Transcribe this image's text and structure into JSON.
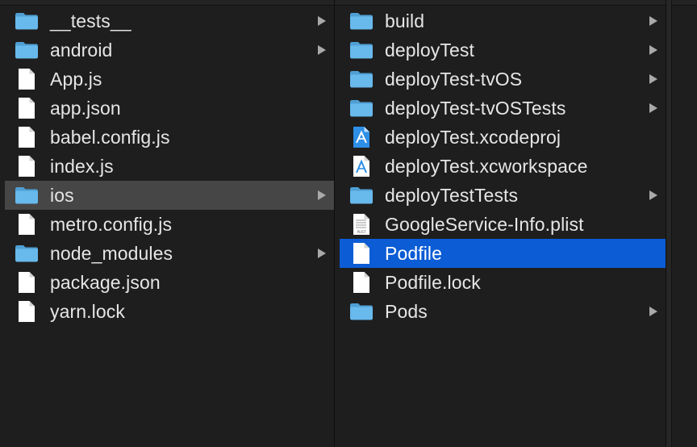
{
  "columns": [
    {
      "items": [
        {
          "label": "__tests__",
          "icon": "folder-icon",
          "has_children": true,
          "state": "normal"
        },
        {
          "label": "android",
          "icon": "folder-icon",
          "has_children": true,
          "state": "normal"
        },
        {
          "label": "App.js",
          "icon": "document-icon",
          "has_children": false,
          "state": "normal"
        },
        {
          "label": "app.json",
          "icon": "document-icon",
          "has_children": false,
          "state": "normal"
        },
        {
          "label": "babel.config.js",
          "icon": "document-icon",
          "has_children": false,
          "state": "normal"
        },
        {
          "label": "index.js",
          "icon": "document-icon",
          "has_children": false,
          "state": "normal"
        },
        {
          "label": "ios",
          "icon": "folder-icon",
          "has_children": true,
          "state": "path-selected"
        },
        {
          "label": "metro.config.js",
          "icon": "document-icon",
          "has_children": false,
          "state": "normal"
        },
        {
          "label": "node_modules",
          "icon": "folder-icon",
          "has_children": true,
          "state": "normal"
        },
        {
          "label": "package.json",
          "icon": "document-icon",
          "has_children": false,
          "state": "normal"
        },
        {
          "label": "yarn.lock",
          "icon": "document-icon",
          "has_children": false,
          "state": "normal"
        }
      ]
    },
    {
      "items": [
        {
          "label": "build",
          "icon": "folder-icon",
          "has_children": true,
          "state": "normal"
        },
        {
          "label": "deployTest",
          "icon": "folder-icon",
          "has_children": true,
          "state": "normal"
        },
        {
          "label": "deployTest-tvOS",
          "icon": "folder-icon",
          "has_children": true,
          "state": "normal"
        },
        {
          "label": "deployTest-tvOSTests",
          "icon": "folder-icon",
          "has_children": true,
          "state": "normal"
        },
        {
          "label": "deployTest.xcodeproj",
          "icon": "xcodeproj-icon",
          "has_children": false,
          "state": "normal"
        },
        {
          "label": "deployTest.xcworkspace",
          "icon": "xcworkspace-icon",
          "has_children": false,
          "state": "normal"
        },
        {
          "label": "deployTestTests",
          "icon": "folder-icon",
          "has_children": true,
          "state": "normal"
        },
        {
          "label": "GoogleService-Info.plist",
          "icon": "plist-icon",
          "plist_badge": "PLIST",
          "has_children": false,
          "state": "normal"
        },
        {
          "label": "Podfile",
          "icon": "document-icon",
          "has_children": false,
          "state": "selected"
        },
        {
          "label": "Podfile.lock",
          "icon": "document-icon",
          "has_children": false,
          "state": "normal"
        },
        {
          "label": "Pods",
          "icon": "folder-icon",
          "has_children": true,
          "state": "normal"
        }
      ]
    }
  ],
  "colors": {
    "background": "#1e1e1e",
    "selection": "#0b5cd5",
    "path_selection": "#464646",
    "folder": "#5fb2e6",
    "text": "#e6e6e6"
  }
}
